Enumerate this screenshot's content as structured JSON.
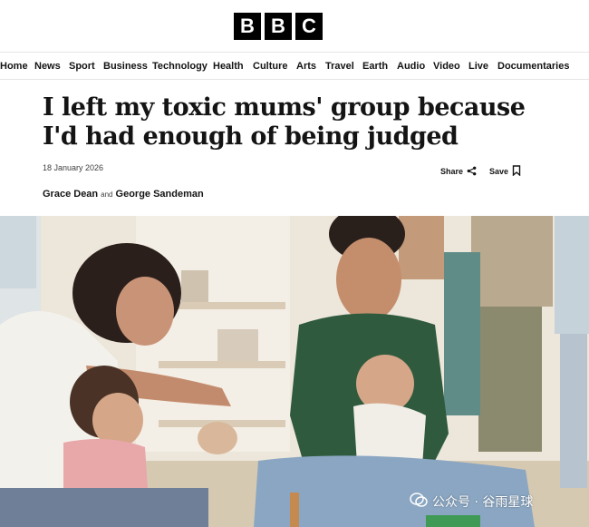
{
  "brand": {
    "letters": [
      "B",
      "B",
      "C"
    ]
  },
  "nav": {
    "items": [
      "Home",
      "News",
      "Sport",
      "Business",
      "Technology",
      "Health",
      "Culture",
      "Arts",
      "Travel",
      "Earth",
      "Audio",
      "Video",
      "Live",
      "Documentaries"
    ]
  },
  "article": {
    "headline": "I left my toxic mums' group because I'd had enough of being judged",
    "date": "18 January 2026",
    "share_label": "Share",
    "save_label": "Save",
    "author1": "Grace Dean",
    "and_text": "and",
    "author2": "George Sandeman"
  },
  "watermark": {
    "text": "公众号 · 谷雨星球"
  },
  "colors": {
    "background": "#ffffff",
    "text": "#141414",
    "logo_block": "#000000",
    "divider": "#e5e5e5"
  }
}
